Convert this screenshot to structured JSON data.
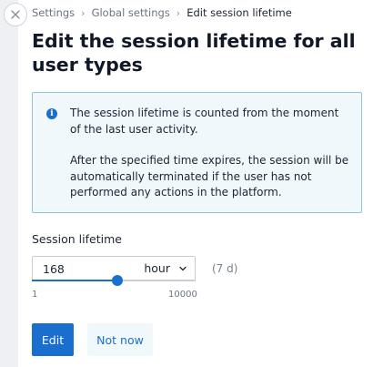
{
  "breadcrumb": {
    "items": [
      "Settings",
      "Global settings",
      "Edit session lifetime"
    ],
    "separator": "›"
  },
  "page": {
    "title": "Edit the session lifetime for all user types"
  },
  "info": {
    "icon": "info-icon",
    "paragraphs": [
      "The session lifetime is counted from the moment of the last user activity.",
      "After the specified time expires, the session will be automatically terminated if the user has not performed any actions in the platform."
    ]
  },
  "session_lifetime": {
    "label": "Session lifetime",
    "value": "168",
    "unit": "hour",
    "duration_hint": "(7 d)",
    "slider": {
      "min": 1,
      "max": 10000,
      "min_label": "1",
      "max_label": "10000",
      "position_fraction": 0.52
    }
  },
  "actions": {
    "primary_label": "Edit",
    "secondary_label": "Not now"
  },
  "colors": {
    "accent": "#1a6fce",
    "info_background": "#f1f8fc",
    "info_border": "#8cc4e3"
  }
}
